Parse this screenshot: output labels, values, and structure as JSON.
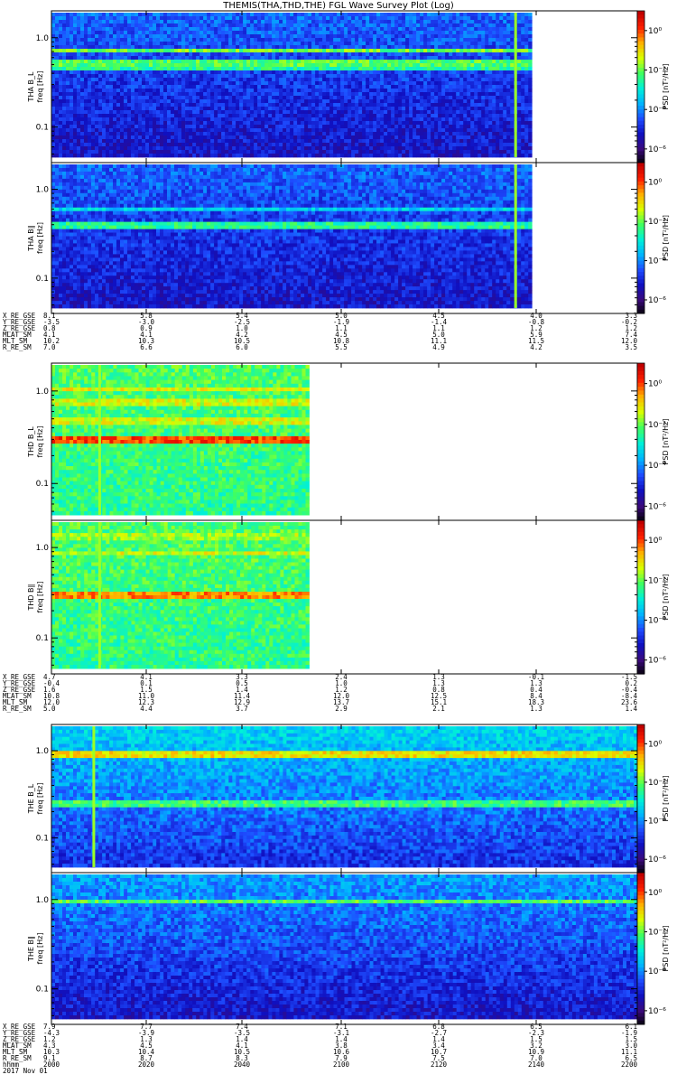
{
  "title": "THEMIS(THA,THD,THE) FGL Wave Survey Plot (Log)",
  "colors": {
    "colormap": [
      "#000000",
      "#3a0a7a",
      "#1010c0",
      "#1e4cff",
      "#00b4ff",
      "#00f0d8",
      "#40ff60",
      "#d8ff00",
      "#ffb000",
      "#ff2000",
      "#c00000"
    ],
    "background_missing": "#ffffff"
  },
  "chart_data": [
    {
      "type": "heatmap",
      "probe": "THA",
      "component": "B_L",
      "ylabel": "THA B_L",
      "ylabel2": "freq [Hz]",
      "zlabel": "PSD [nT²/Hz]",
      "yscale": "log",
      "ylim": [
        0.04,
        2.0
      ],
      "yticks": [
        "1.0",
        "0.1"
      ],
      "zticks": [
        "10⁰",
        "10⁻²",
        "10⁻⁴",
        "10⁻⁶"
      ],
      "data_end_fraction": 0.82,
      "vertical_artifact_fraction": 0.79,
      "features": [
        {
          "freq": 0.75,
          "level": 0.62
        },
        {
          "freq": 0.55,
          "level": 0.6
        },
        {
          "freq": 0.5,
          "level": 0.55
        }
      ],
      "base_level": [
        0.32,
        0.2
      ]
    },
    {
      "type": "heatmap",
      "probe": "THA",
      "component": "B_II",
      "ylabel": "THA B∥",
      "ylabel2": "freq [Hz]",
      "zlabel": "PSD [nT²/Hz]",
      "yscale": "log",
      "ylim": [
        0.04,
        2.0
      ],
      "yticks": [
        "1.0",
        "0.1"
      ],
      "zticks": [
        "10⁰",
        "10⁻²",
        "10⁻⁴",
        "10⁻⁶"
      ],
      "data_end_fraction": 0.82,
      "vertical_artifact_fraction": 0.79,
      "features": [
        {
          "freq": 0.4,
          "level": 0.55
        },
        {
          "freq": 0.62,
          "level": 0.45
        }
      ],
      "base_level": [
        0.32,
        0.2
      ]
    },
    {
      "type": "heatmap",
      "probe": "THD",
      "component": "B_L",
      "ylabel": "THD B_L",
      "ylabel2": "freq [Hz]",
      "zlabel": "PSD [nT²/Hz]",
      "yscale": "log",
      "ylim": [
        0.04,
        2.0
      ],
      "yticks": [
        "1.0",
        "0.1"
      ],
      "zticks": [
        "10⁰",
        "10⁻²",
        "10⁻⁴",
        "10⁻⁶"
      ],
      "data_end_fraction": 0.44,
      "vertical_artifact_fraction": 0.08,
      "features": [
        {
          "freq": 0.3,
          "level": 0.88
        },
        {
          "freq": 1.1,
          "level": 0.72
        },
        {
          "freq": 0.8,
          "level": 0.7
        },
        {
          "freq": 0.5,
          "level": 0.7
        }
      ],
      "base_level": [
        0.6,
        0.56
      ]
    },
    {
      "type": "heatmap",
      "probe": "THD",
      "component": "B_II",
      "ylabel": "THD B∥",
      "ylabel2": "freq [Hz]",
      "zlabel": "PSD [nT²/Hz]",
      "yscale": "log",
      "ylim": [
        0.04,
        2.0
      ],
      "yticks": [
        "1.0",
        "0.1"
      ],
      "zticks": [
        "10⁰",
        "10⁻²",
        "10⁻⁴",
        "10⁻⁶"
      ],
      "data_end_fraction": 0.44,
      "vertical_artifact_fraction": 0.08,
      "features": [
        {
          "freq": 0.3,
          "level": 0.82
        },
        {
          "freq": 0.9,
          "level": 0.7
        },
        {
          "freq": 1.4,
          "level": 0.66
        }
      ],
      "base_level": [
        0.6,
        0.56
      ]
    },
    {
      "type": "heatmap",
      "probe": "THE",
      "component": "B_L",
      "ylabel": "THE B_L",
      "ylabel2": "freq [Hz]",
      "zlabel": "PSD [nT²/Hz]",
      "yscale": "log",
      "ylim": [
        0.04,
        2.0
      ],
      "yticks": [
        "1.0",
        "0.1"
      ],
      "zticks": [
        "10⁰",
        "10⁻²",
        "10⁻⁴",
        "10⁻⁶"
      ],
      "data_end_fraction": 1.0,
      "vertical_artifact_fraction": 0.07,
      "features": [
        {
          "freq": 0.95,
          "level": 0.74
        },
        {
          "freq": 0.25,
          "level": 0.58
        }
      ],
      "base_level": [
        0.45,
        0.25
      ]
    },
    {
      "type": "heatmap",
      "probe": "THE",
      "component": "B_II",
      "ylabel": "THE B∥",
      "ylabel2": "freq [Hz]",
      "zlabel": "PSD [nT²/Hz]",
      "yscale": "log",
      "ylim": [
        0.04,
        2.0
      ],
      "yticks": [
        "1.0",
        "0.1"
      ],
      "zticks": [
        "10⁰",
        "10⁻²",
        "10⁻⁴",
        "10⁻⁶"
      ],
      "data_end_fraction": 1.0,
      "vertical_artifact_fraction": null,
      "features": [
        {
          "freq": 1.0,
          "level": 0.6
        }
      ],
      "base_level": [
        0.38,
        0.2
      ]
    }
  ],
  "ephemeris": [
    {
      "probe": "THA",
      "rows": [
        {
          "label": "X_RE_GSE",
          "values": [
            "8.1",
            "5.8",
            "5.4",
            "5.0",
            "4.5",
            "4.0",
            "3.3"
          ]
        },
        {
          "label": "Y_RE_GSE",
          "values": [
            "-3.5",
            "-3.0",
            "-2.5",
            "-1.9",
            "-1.4",
            "-0.8",
            "-0.2"
          ]
        },
        {
          "label": "Z_RE_GSE",
          "values": [
            "0.8",
            "0.9",
            "1.0",
            "1.1",
            "1.1",
            "1.2",
            "1.2"
          ]
        },
        {
          "label": "MLAT_SM",
          "values": [
            "4.1",
            "4.1",
            "4.2",
            "4.5",
            "5.0",
            "5.9",
            "7.4"
          ]
        },
        {
          "label": "MLT_SM",
          "values": [
            "10.2",
            "10.3",
            "10.5",
            "10.8",
            "11.1",
            "11.5",
            "12.0"
          ]
        },
        {
          "label": "R_RE_SM",
          "values": [
            "7.0",
            "6.6",
            "6.0",
            "5.5",
            "4.9",
            "4.2",
            "3.5"
          ]
        }
      ]
    },
    {
      "probe": "THD",
      "rows": [
        {
          "label": "X_RE_GSE",
          "values": [
            "4.7",
            "4.1",
            "3.3",
            "2.4",
            "1.3",
            "-0.1",
            "-1.5"
          ]
        },
        {
          "label": "Y_RE_GSE",
          "values": [
            "-0.4",
            "0.1",
            "0.5",
            "1.0",
            "1.3",
            "1.3",
            "0.2"
          ]
        },
        {
          "label": "Z_RE_GSE",
          "values": [
            "1.6",
            "1.5",
            "1.4",
            "1.2",
            "0.8",
            "0.4",
            "-0.4"
          ]
        },
        {
          "label": "MLAT_SM",
          "values": [
            "10.8",
            "11.0",
            "11.4",
            "12.0",
            "12.5",
            "8.4",
            "-8.4"
          ]
        },
        {
          "label": "MLT_SM",
          "values": [
            "12.0",
            "12.3",
            "12.9",
            "13.7",
            "15.1",
            "18.3",
            "23.6"
          ]
        },
        {
          "label": "R_RE_SM",
          "values": [
            "5.0",
            "4.4",
            "3.7",
            "2.9",
            "2.1",
            "1.3",
            "1.4"
          ]
        }
      ]
    },
    {
      "probe": "THE",
      "rows": [
        {
          "label": "X_RE_GSE",
          "values": [
            "7.9",
            "7.7",
            "7.4",
            "7.1",
            "6.8",
            "6.5",
            "6.1"
          ]
        },
        {
          "label": "Y_RE_GSE",
          "values": [
            "-4.3",
            "-3.9",
            "-3.5",
            "-3.1",
            "-2.7",
            "-2.3",
            "-1.9"
          ]
        },
        {
          "label": "Z_RE_GSE",
          "values": [
            "1.2",
            "1.3",
            "1.4",
            "1.4",
            "1.4",
            "1.5",
            "1.5"
          ]
        },
        {
          "label": "MLAT_SM",
          "values": [
            "4.3",
            "4.5",
            "4.1",
            "3.8",
            "3.4",
            "3.2",
            "3.0"
          ]
        },
        {
          "label": "MLT_SM",
          "values": [
            "10.3",
            "10.4",
            "10.5",
            "10.6",
            "10.7",
            "10.9",
            "11.1"
          ]
        },
        {
          "label": "R_RE_SM",
          "values": [
            "9.1",
            "8.7",
            "8.3",
            "7.9",
            "7.5",
            "7.0",
            "6.5"
          ]
        },
        {
          "label": "hhmm",
          "values": [
            "2000",
            "2020",
            "2040",
            "2100",
            "2120",
            "2140",
            "2200"
          ]
        }
      ],
      "date_label": "2017 Nov 01"
    }
  ]
}
